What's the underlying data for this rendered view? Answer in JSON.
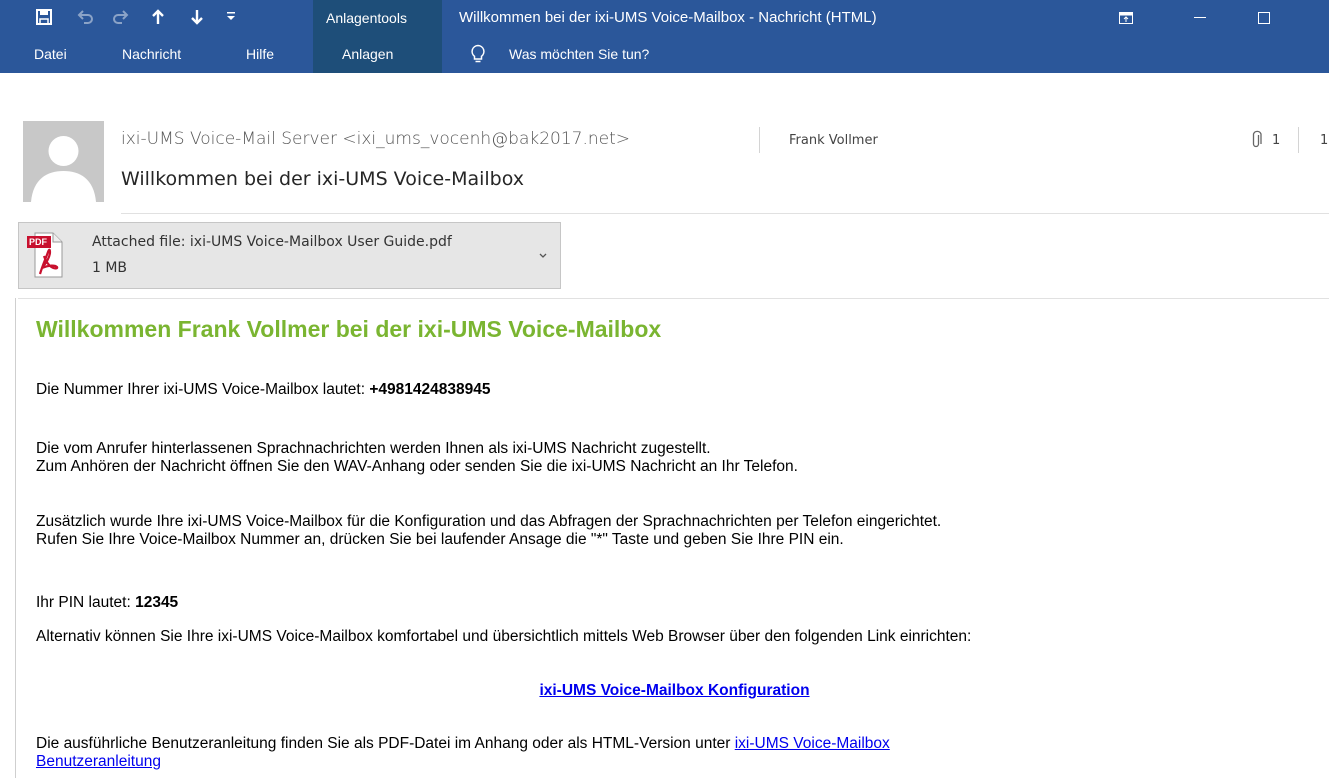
{
  "titlebar": {
    "context_group": "Anlagentools",
    "window_title": "Willkommen bei der ixi-UMS Voice-Mailbox  -  Nachricht (HTML)",
    "qat_icons": [
      "save-icon",
      "undo-icon",
      "redo-icon",
      "up-arrow-icon",
      "down-arrow-icon",
      "customize-qat-icon"
    ],
    "window_buttons": [
      "ribbon-display-options-icon",
      "minimize-icon",
      "maximize-icon"
    ]
  },
  "ribbon": {
    "tabs": [
      "Datei",
      "Nachricht",
      "Hilfe",
      "Anlagen"
    ],
    "active_tab": "Anlagen",
    "tell_me": "Was möchten Sie tun?"
  },
  "message": {
    "sender": "ixi-UMS Voice-Mail Server <ixi_ums_vocenh@bak2017.net>",
    "recipient": "Frank Vollmer",
    "attachment_count": "1",
    "cut_text": "1",
    "subject": "Willkommen bei der ixi-UMS Voice-Mailbox"
  },
  "attachment": {
    "icon_label": "PDF",
    "name": "Attached file: ixi-UMS Voice-Mailbox User Guide.pdf",
    "size": "1 MB"
  },
  "body": {
    "headline": "Willkommen Frank Vollmer bei der ixi-UMS Voice-Mailbox",
    "number_label": "Die Nummer Ihrer ixi-UMS Voice-Mailbox lautet: ",
    "number_value": "+4981424838945",
    "para1_line1": "Die vom Anrufer hinterlassenen Sprachnachrichten werden Ihnen als ixi-UMS Nachricht zugestellt.",
    "para1_line2": "Zum Anhören der Nachricht öffnen Sie den WAV-Anhang oder senden Sie die ixi-UMS Nachricht an Ihr Telefon.",
    "para2_line1": "Zusätzlich wurde Ihre ixi-UMS Voice-Mailbox für die Konfiguration und das Abfragen der Sprachnachrichten per Telefon eingerichtet.",
    "para2_line2": "Rufen Sie Ihre Voice-Mailbox Nummer an, drücken Sie bei laufender Ansage die \"*\" Taste und geben Sie Ihre PIN ein.",
    "pin_label": "Ihr PIN lautet: ",
    "pin_value": "12345",
    "para3": "Alternativ können Sie Ihre ixi-UMS Voice-Mailbox komfortabel und übersichtlich mittels Web Browser über den folgenden Link einrichten:",
    "config_link": "ixi-UMS Voice-Mailbox Konfiguration",
    "para4_text": "Die ausführliche Benutzeranleitung finden Sie als PDF-Datei im Anhang oder als HTML-Version unter ",
    "para4_link_line1": "ixi-UMS Voice-Mailbox",
    "para4_link_line2": "Benutzeranleitung"
  },
  "colors": {
    "titlebar": "#2b579a",
    "context_tab": "#1e4e79",
    "headline": "#7ab531",
    "link": "#0000ee"
  }
}
